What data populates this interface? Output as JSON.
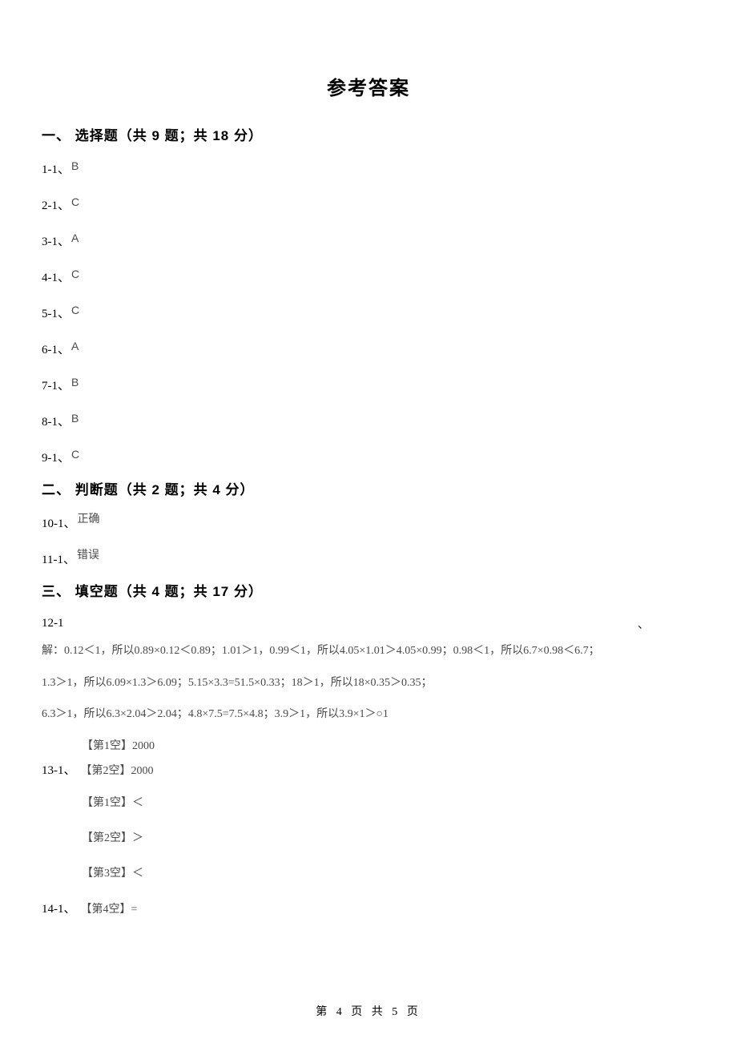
{
  "title": "参考答案",
  "sections": [
    {
      "heading": "一、 选择题（共 9 题；共 18 分）",
      "answers": [
        {
          "num": "1-1、",
          "ans": "B"
        },
        {
          "num": "2-1、",
          "ans": "C"
        },
        {
          "num": "3-1、",
          "ans": "A"
        },
        {
          "num": "4-1、",
          "ans": "C"
        },
        {
          "num": "5-1、",
          "ans": "C"
        },
        {
          "num": "6-1、",
          "ans": "A"
        },
        {
          "num": "7-1、",
          "ans": "B"
        },
        {
          "num": "8-1、",
          "ans": "B"
        },
        {
          "num": "9-1、",
          "ans": "C"
        }
      ]
    },
    {
      "heading": "二、 判断题（共 2 题；共 4 分）",
      "answers": [
        {
          "num": "10-1、",
          "ans": "正确"
        },
        {
          "num": "11-1、",
          "ans": "错误"
        }
      ]
    },
    {
      "heading": "三、 填空题（共 4 题；共 17 分）",
      "q12": {
        "num": "12-1",
        "trailing": "、",
        "lines": [
          "解：0.12＜1，所以0.89×0.12＜0.89；1.01＞1，0.99＜1，所以4.05×1.01＞4.05×0.99；0.98＜1，所以6.7×0.98＜6.7；",
          "1.3＞1，所以6.09×1.3＞6.09；5.15×3.3=51.5×0.33；18＞1，所以18×0.35＞0.35；",
          "6.3＞1，所以6.3×2.04＞2.04；4.8×7.5=7.5×4.8；3.9＞1，所以3.9×1＞○1"
        ]
      },
      "q13": {
        "num": "13-1、",
        "blanks": [
          "【第1空】2000",
          "【第2空】2000"
        ]
      },
      "q14": {
        "num": "14-1、",
        "blanks": [
          "【第1空】＜",
          "【第2空】＞",
          "【第3空】＜",
          "【第4空】="
        ]
      }
    }
  ],
  "footer": "第 4 页 共 5 页"
}
